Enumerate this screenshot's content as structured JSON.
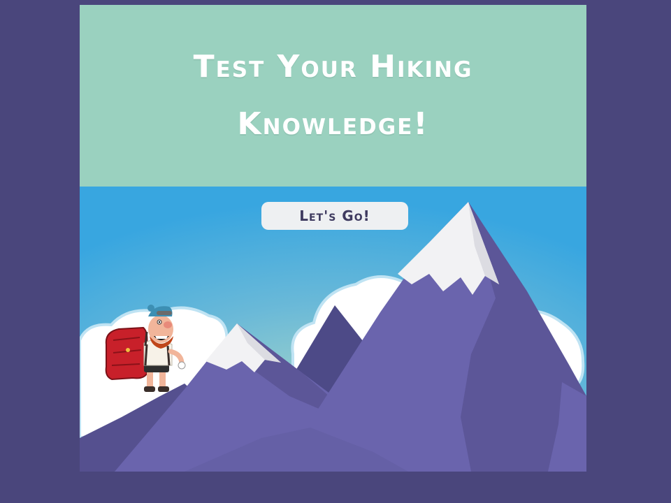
{
  "header": {
    "title_line_1": "Test Your Hiking",
    "title_line_2": "Knowledge!"
  },
  "actions": {
    "start_label": "Let's Go!"
  },
  "illustration": {
    "hiker": "cartoon-hiker-with-red-backpack",
    "scenery": "snow-capped-mountains-and-clouds"
  },
  "colors": {
    "page_background": "#4a467c",
    "header_background": "#9ad1bf",
    "sky_top": "#3aa8df",
    "sky_bottom": "#a7d6c8",
    "mountain": "#6a64ad",
    "mountain_shadow": "#5a5496",
    "snow": "#f2f2f4",
    "button_background": "#eef0f2",
    "button_text": "#3e3a5f"
  }
}
